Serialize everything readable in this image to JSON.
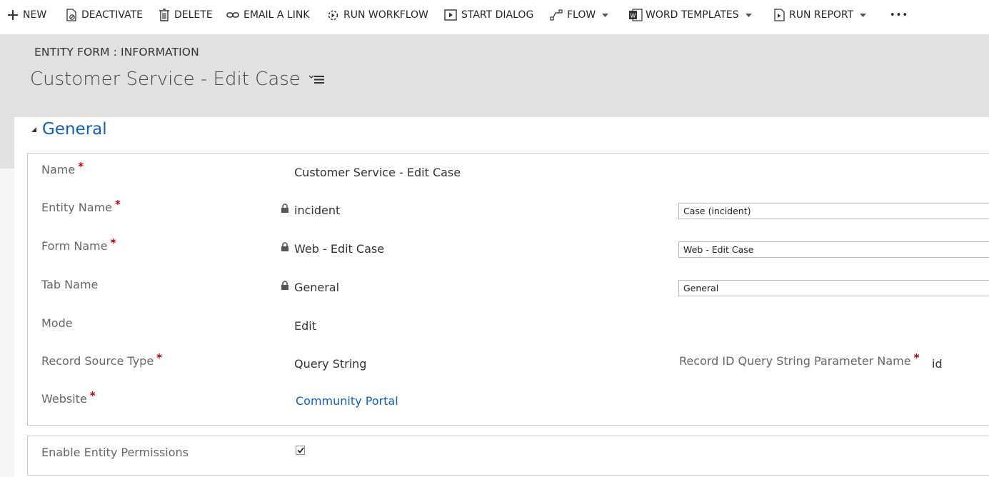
{
  "commandbar": {
    "new": "NEW",
    "deactivate": "DEACTIVATE",
    "delete": "DELETE",
    "email_link": "EMAIL A LINK",
    "run_workflow": "RUN WORKFLOW",
    "start_dialog": "START DIALOG",
    "flow": "FLOW",
    "word_templates": "WORD TEMPLATES",
    "run_report": "RUN REPORT",
    "more": "•••"
  },
  "header": {
    "entity_label": "ENTITY FORM : INFORMATION",
    "title": "Customer Service - Edit Case"
  },
  "section": {
    "title": "General"
  },
  "fields": {
    "name": {
      "label": "Name",
      "required": "*",
      "value": "Customer Service - Edit Case"
    },
    "entity_name": {
      "label": "Entity Name",
      "required": "*",
      "value": "incident",
      "display": "Case (incident)"
    },
    "form_name": {
      "label": "Form Name",
      "required": "*",
      "value": "Web - Edit Case",
      "display": "Web - Edit Case"
    },
    "tab_name": {
      "label": "Tab Name",
      "value": "General",
      "display": "General"
    },
    "mode": {
      "label": "Mode",
      "value": "Edit"
    },
    "record_source_type": {
      "label": "Record Source Type",
      "required": "*",
      "value": "Query String"
    },
    "record_id_param": {
      "label": "Record ID Query String Parameter Name",
      "required": "*",
      "value": "id"
    },
    "website": {
      "label": "Website",
      "required": "*",
      "value": "Community Portal"
    },
    "enable_permissions": {
      "label": "Enable Entity Permissions",
      "checked": true
    }
  },
  "colors": {
    "accent": "#1160b7",
    "required": "#c00000",
    "header_bg": "#e1e1e1"
  }
}
